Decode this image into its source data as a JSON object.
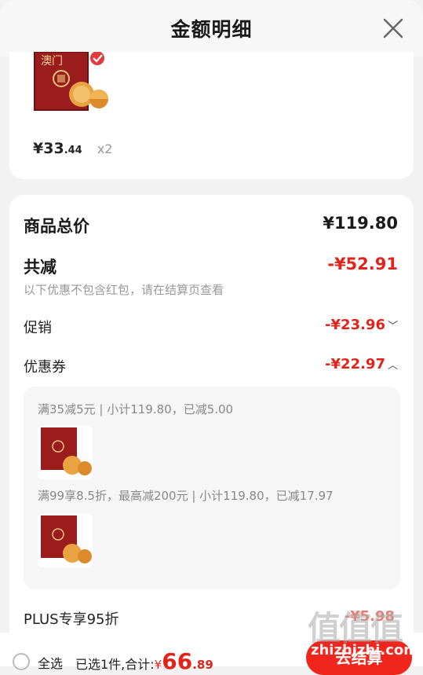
{
  "header": {
    "title": "金额明细",
    "close_icon": "close-icon"
  },
  "item": {
    "price_symbol": "¥",
    "price_int": "33",
    "price_dec": ".44",
    "qty": "x2",
    "brand_text": "澳门"
  },
  "summary": {
    "total_label": "商品总价",
    "total_value": "¥119.80",
    "reduce_label": "共减",
    "reduce_value": "-¥52.91",
    "note": "以下优惠不包含红包，请在结算页查看",
    "promo_label": "促销",
    "promo_value": "-¥23.96",
    "coupon_label": "优惠券",
    "coupon_value": "-¥22.97",
    "coupon_lines": [
      "满35减5元 | 小计119.80，已减5.00",
      "满99享8.5折，最高减200元 | 小计119.80，已减17.97"
    ],
    "plus_label": "PLUS专享95折",
    "plus_value": "-¥5.98"
  },
  "footer": {
    "select_all": "全选",
    "selected_prefix": "已选1件,合计:",
    "amount_yen": "¥",
    "amount_int": "66",
    "amount_dec": ".89",
    "checkout": "去结算"
  },
  "watermark": {
    "text": "值值值",
    "url": "zhizhizhi.com"
  },
  "colors": {
    "accent": "#e2231a",
    "checkout_bg": "#f0251b",
    "product_red": "#9b1c1c",
    "badge_red": "#e23b3b"
  }
}
